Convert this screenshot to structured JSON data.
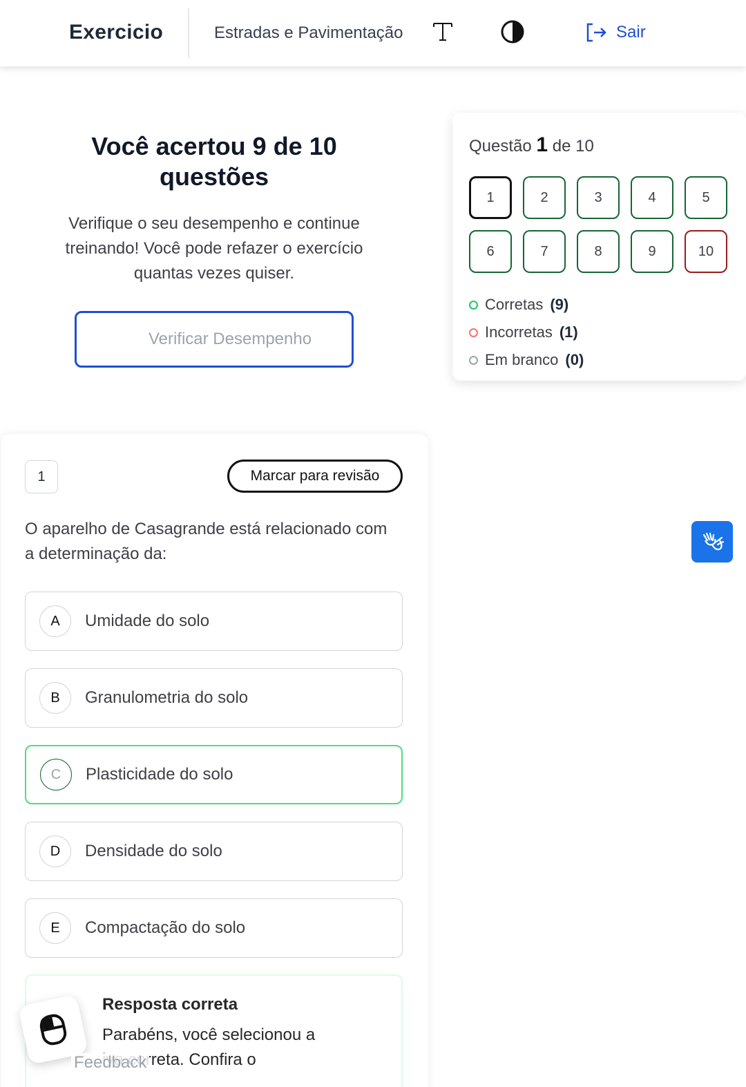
{
  "header": {
    "app_title": "Exercicio",
    "course_name": "Estradas e Pavimentação",
    "font_icon": "font-size-icon",
    "contrast_icon": "contrast-icon",
    "logout_label": "Sair",
    "logout_icon": "logout-icon",
    "accent_color": "#1d4ed8"
  },
  "result": {
    "title": "Você acertou 9 de 10 questões",
    "description": "Verifique o seu desempenho e continue treinando! Você pode refazer o exercício quantas vezes quiser.",
    "verify_button": "Verificar Desempenho"
  },
  "navigator": {
    "prefix": "Questão",
    "current": "1",
    "suffix": "de 10",
    "questions": [
      {
        "label": "1",
        "status": "current"
      },
      {
        "label": "2",
        "status": "correct"
      },
      {
        "label": "3",
        "status": "correct"
      },
      {
        "label": "4",
        "status": "correct"
      },
      {
        "label": "5",
        "status": "correct"
      },
      {
        "label": "6",
        "status": "correct"
      },
      {
        "label": "7",
        "status": "correct"
      },
      {
        "label": "8",
        "status": "correct"
      },
      {
        "label": "9",
        "status": "correct"
      },
      {
        "label": "10",
        "status": "wrong"
      }
    ],
    "legend": {
      "correct_label": "Corretas",
      "correct_count": "(9)",
      "incorrect_label": "Incorretas",
      "incorrect_count": "(1)",
      "blank_label": "Em branco",
      "blank_count": "(0)"
    },
    "colors": {
      "correct": "#166534",
      "wrong": "#991b1b",
      "current": "#111111"
    }
  },
  "question": {
    "number": "1",
    "review_button": "Marcar para revisão",
    "text": "O aparelho de Casagrande está relacionado com a determinação da:",
    "options": [
      {
        "letter": "A",
        "text": "Umidade do solo"
      },
      {
        "letter": "B",
        "text": "Granulometria do solo"
      },
      {
        "letter": "C",
        "text": "Plasticidade do solo",
        "correct": true
      },
      {
        "letter": "D",
        "text": "Densidade do solo"
      },
      {
        "letter": "E",
        "text": "Compactação do solo"
      }
    ],
    "feedback_title": "Resposta correta",
    "feedback_line1": "Parabéns, você selecionou a",
    "feedback_line2": "iva correta. Confira o"
  },
  "widgets": {
    "libras_icon": "sign-language-hands-icon",
    "feedback_icon": "mouse-icon",
    "feedback_label": "Feedback"
  }
}
